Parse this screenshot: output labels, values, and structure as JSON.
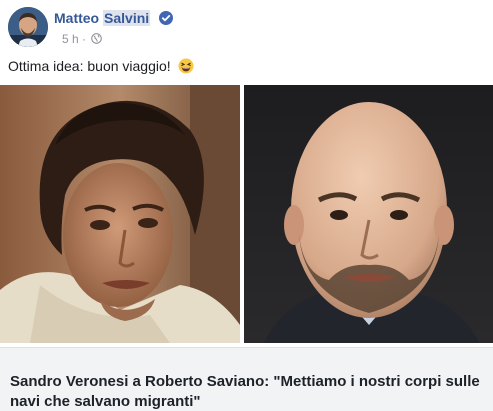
{
  "post": {
    "author_first": "Matteo",
    "author_last": "Salvini",
    "verified_icon": "verified-badge-icon",
    "time": "5 h",
    "separator": "·",
    "audience_icon": "globe-icon",
    "message": "Ottima idea: buon viaggio!",
    "message_emoji": "grinning-squinting-face-emoji"
  },
  "link_preview": {
    "title": "Sandro Veronesi a Roberto Saviano: \"Mettiamo i nostri corpi sulle navi che salvano migranti\""
  },
  "colors": {
    "author_link": "#365899",
    "meta_gray": "#90949c",
    "preview_bg": "#f2f3f5",
    "verified_blue": "#4267b2"
  }
}
